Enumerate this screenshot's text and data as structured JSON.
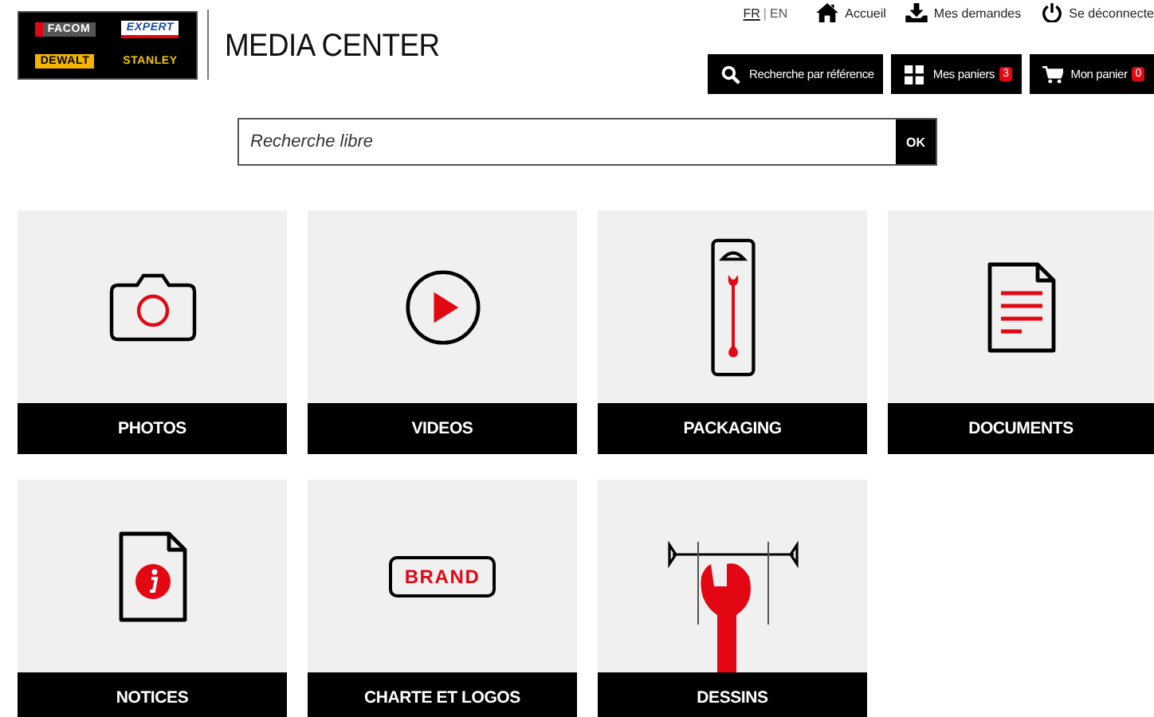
{
  "logo": {
    "brands": [
      {
        "label": "FACOM",
        "kind": "facom"
      },
      {
        "label": "EXPERT",
        "kind": "expert"
      },
      {
        "label": "DEWALT",
        "kind": "dewalt"
      },
      {
        "label": "STANLEY",
        "kind": "stanley"
      }
    ]
  },
  "title": "MEDIA CENTER",
  "languages": [
    {
      "label": "FR",
      "selected": true
    },
    {
      "label": "EN",
      "selected": false
    }
  ],
  "language_separator": "|",
  "top_links": [
    {
      "label": "Accueil",
      "kind": "home"
    },
    {
      "label": "Mes demandes",
      "kind": "download"
    },
    {
      "label": "Se déconnecte",
      "kind": "power"
    }
  ],
  "action_buttons": [
    {
      "label": "Recherche par référence",
      "kind": "search"
    },
    {
      "label": "Mes paniers",
      "kind": "grid",
      "badge": "3"
    },
    {
      "label": "Mon panier",
      "kind": "cart",
      "badge": "0"
    }
  ],
  "search": {
    "placeholder": "Recherche libre",
    "button": "OK"
  },
  "tiles": [
    {
      "label": "PHOTOS",
      "kind": "camera"
    },
    {
      "label": "VIDEOS",
      "kind": "play"
    },
    {
      "label": "PACKAGING",
      "kind": "packaging"
    },
    {
      "label": "DOCUMENTS",
      "kind": "document"
    },
    {
      "label": "NOTICES",
      "kind": "notice"
    },
    {
      "label": "CHARTE ET LOGOS",
      "kind": "brand",
      "icon_text": "BRAND"
    },
    {
      "label": "DESSINS",
      "kind": "drawing"
    }
  ]
}
